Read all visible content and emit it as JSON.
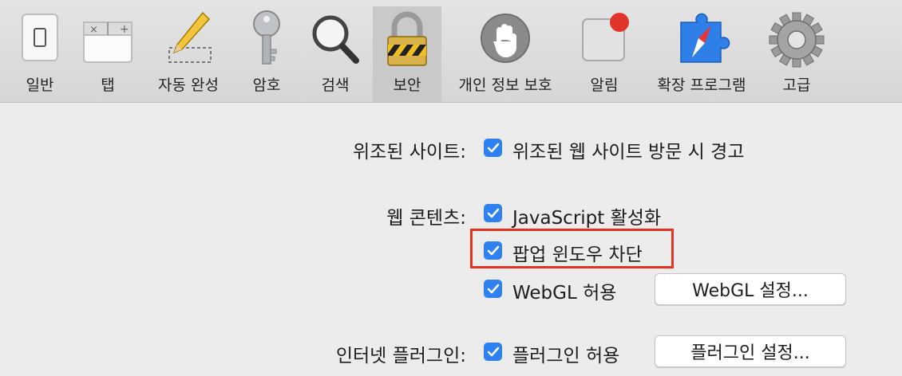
{
  "toolbar": {
    "tabs": [
      {
        "label": "일반",
        "icon": "switch-icon"
      },
      {
        "label": "탭",
        "icon": "tabs-icon"
      },
      {
        "label": "자동 완성",
        "icon": "pencil-icon"
      },
      {
        "label": "암호",
        "icon": "key-icon"
      },
      {
        "label": "검색",
        "icon": "magnifier-icon"
      },
      {
        "label": "보안",
        "icon": "lock-icon",
        "selected": true
      },
      {
        "label": "개인 정보 보호",
        "icon": "hand-icon"
      },
      {
        "label": "알림",
        "icon": "notification-icon"
      },
      {
        "label": "확장 프로그램",
        "icon": "puzzle-compass-icon"
      },
      {
        "label": "고급",
        "icon": "gear-icon"
      }
    ]
  },
  "security": {
    "fraud": {
      "label": "위조된 사이트:",
      "option": "위조된 웹 사이트 방문 시 경고",
      "checked": true
    },
    "web_content": {
      "label": "웹 콘텐츠:",
      "javascript": {
        "option": "JavaScript 활성화",
        "checked": true
      },
      "popups": {
        "option": "팝업 윈도우 차단",
        "checked": true
      },
      "webgl": {
        "option": "WebGL 허용",
        "checked": true,
        "button": "WebGL 설정..."
      }
    },
    "plugins": {
      "label": "인터넷 플러그인:",
      "option": "플러그인 허용",
      "checked": true,
      "button": "플러그인 설정..."
    }
  },
  "colors": {
    "checkbox": "#2f80f0",
    "highlight": "#e4341f",
    "background": "#ececec"
  }
}
